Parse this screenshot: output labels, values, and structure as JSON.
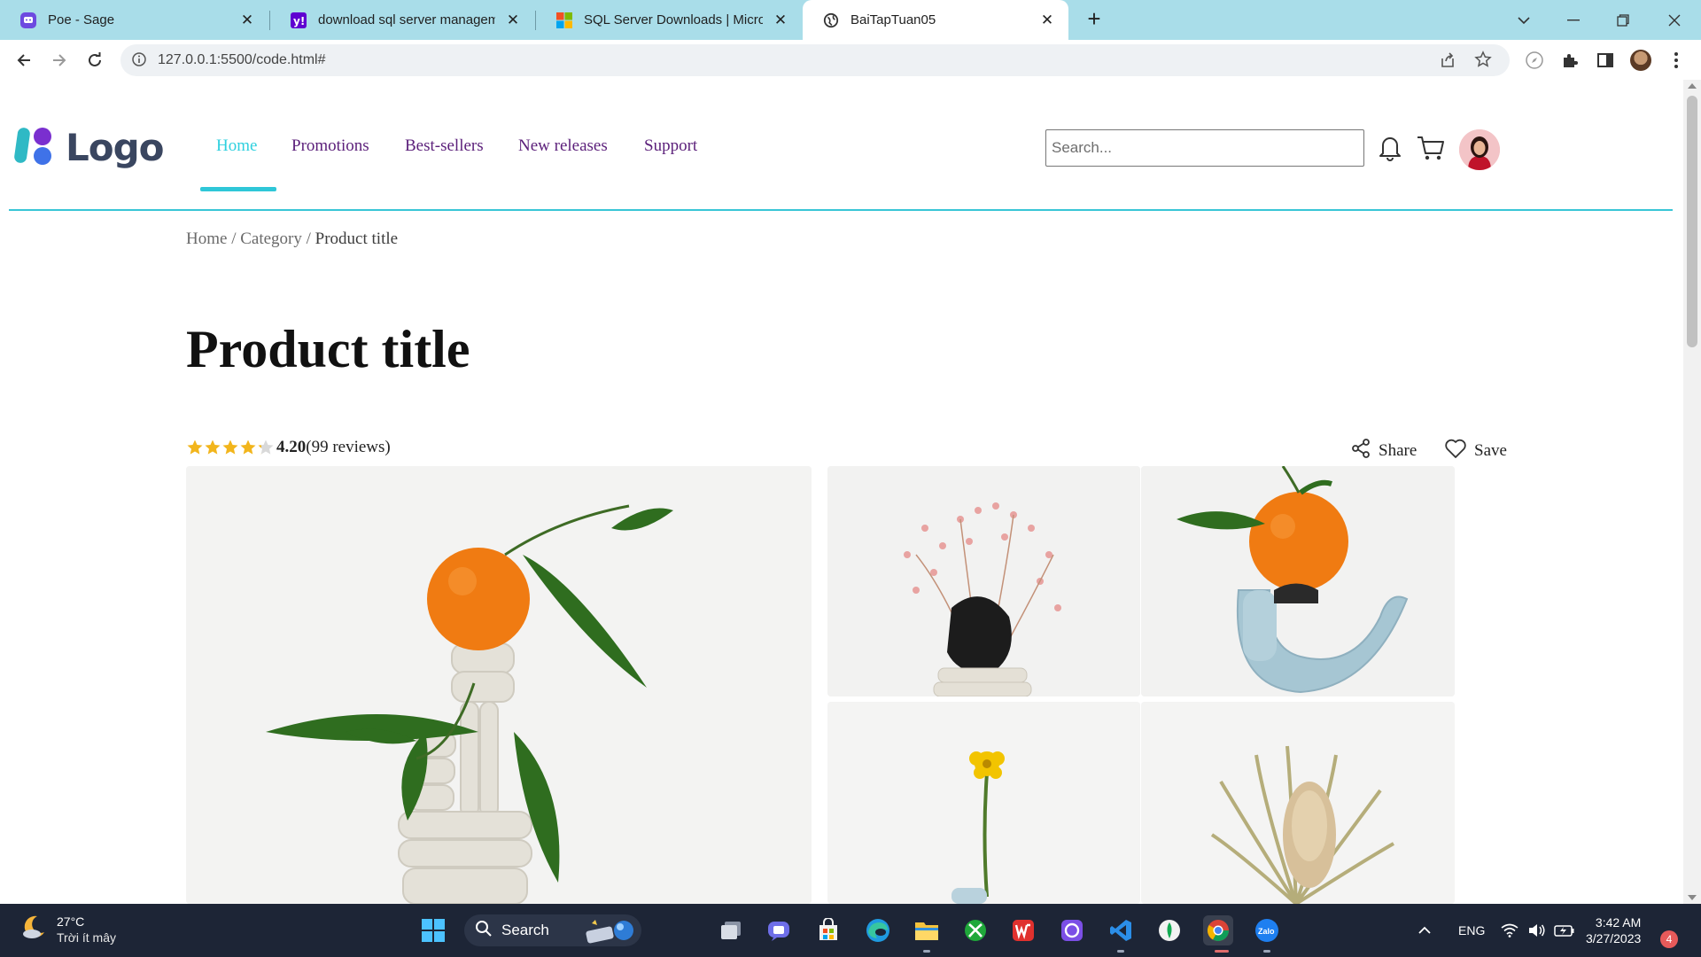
{
  "browser": {
    "tabs": [
      {
        "title": "Poe - Sage",
        "favicon": "poe-icon"
      },
      {
        "title": "download sql server managemen",
        "favicon": "yahoo-icon"
      },
      {
        "title": "SQL Server Downloads | Microsof",
        "favicon": "microsoft-icon"
      },
      {
        "title": "BaiTapTuan05",
        "favicon": "globe-icon"
      }
    ],
    "url": "127.0.0.1:5500/code.html#"
  },
  "site": {
    "logo_text": "Logo",
    "nav": [
      {
        "label": "Home",
        "active": true
      },
      {
        "label": "Promotions"
      },
      {
        "label": "Best-sellers"
      },
      {
        "label": "New releases"
      },
      {
        "label": "Support"
      }
    ],
    "search_placeholder": "Search...",
    "accent_color": "#2fd0df",
    "nav_color": "#5b1f7a"
  },
  "breadcrumb": {
    "home": "Home",
    "sep1": " / ",
    "category": "Category",
    "sep2": " / ",
    "current": "Product title"
  },
  "product": {
    "title": "Product title",
    "rating_value": 4.2,
    "rating_text": "4.20",
    "reviews_text": "(99 reviews)",
    "share_label": "Share",
    "save_label": "Save"
  },
  "taskbar": {
    "weather_temp": "27°C",
    "weather_desc": "Trời ít mây",
    "search_label": "Search",
    "lang": "ENG",
    "time": "3:42 AM",
    "date": "3/27/2023",
    "notifications": "4"
  }
}
